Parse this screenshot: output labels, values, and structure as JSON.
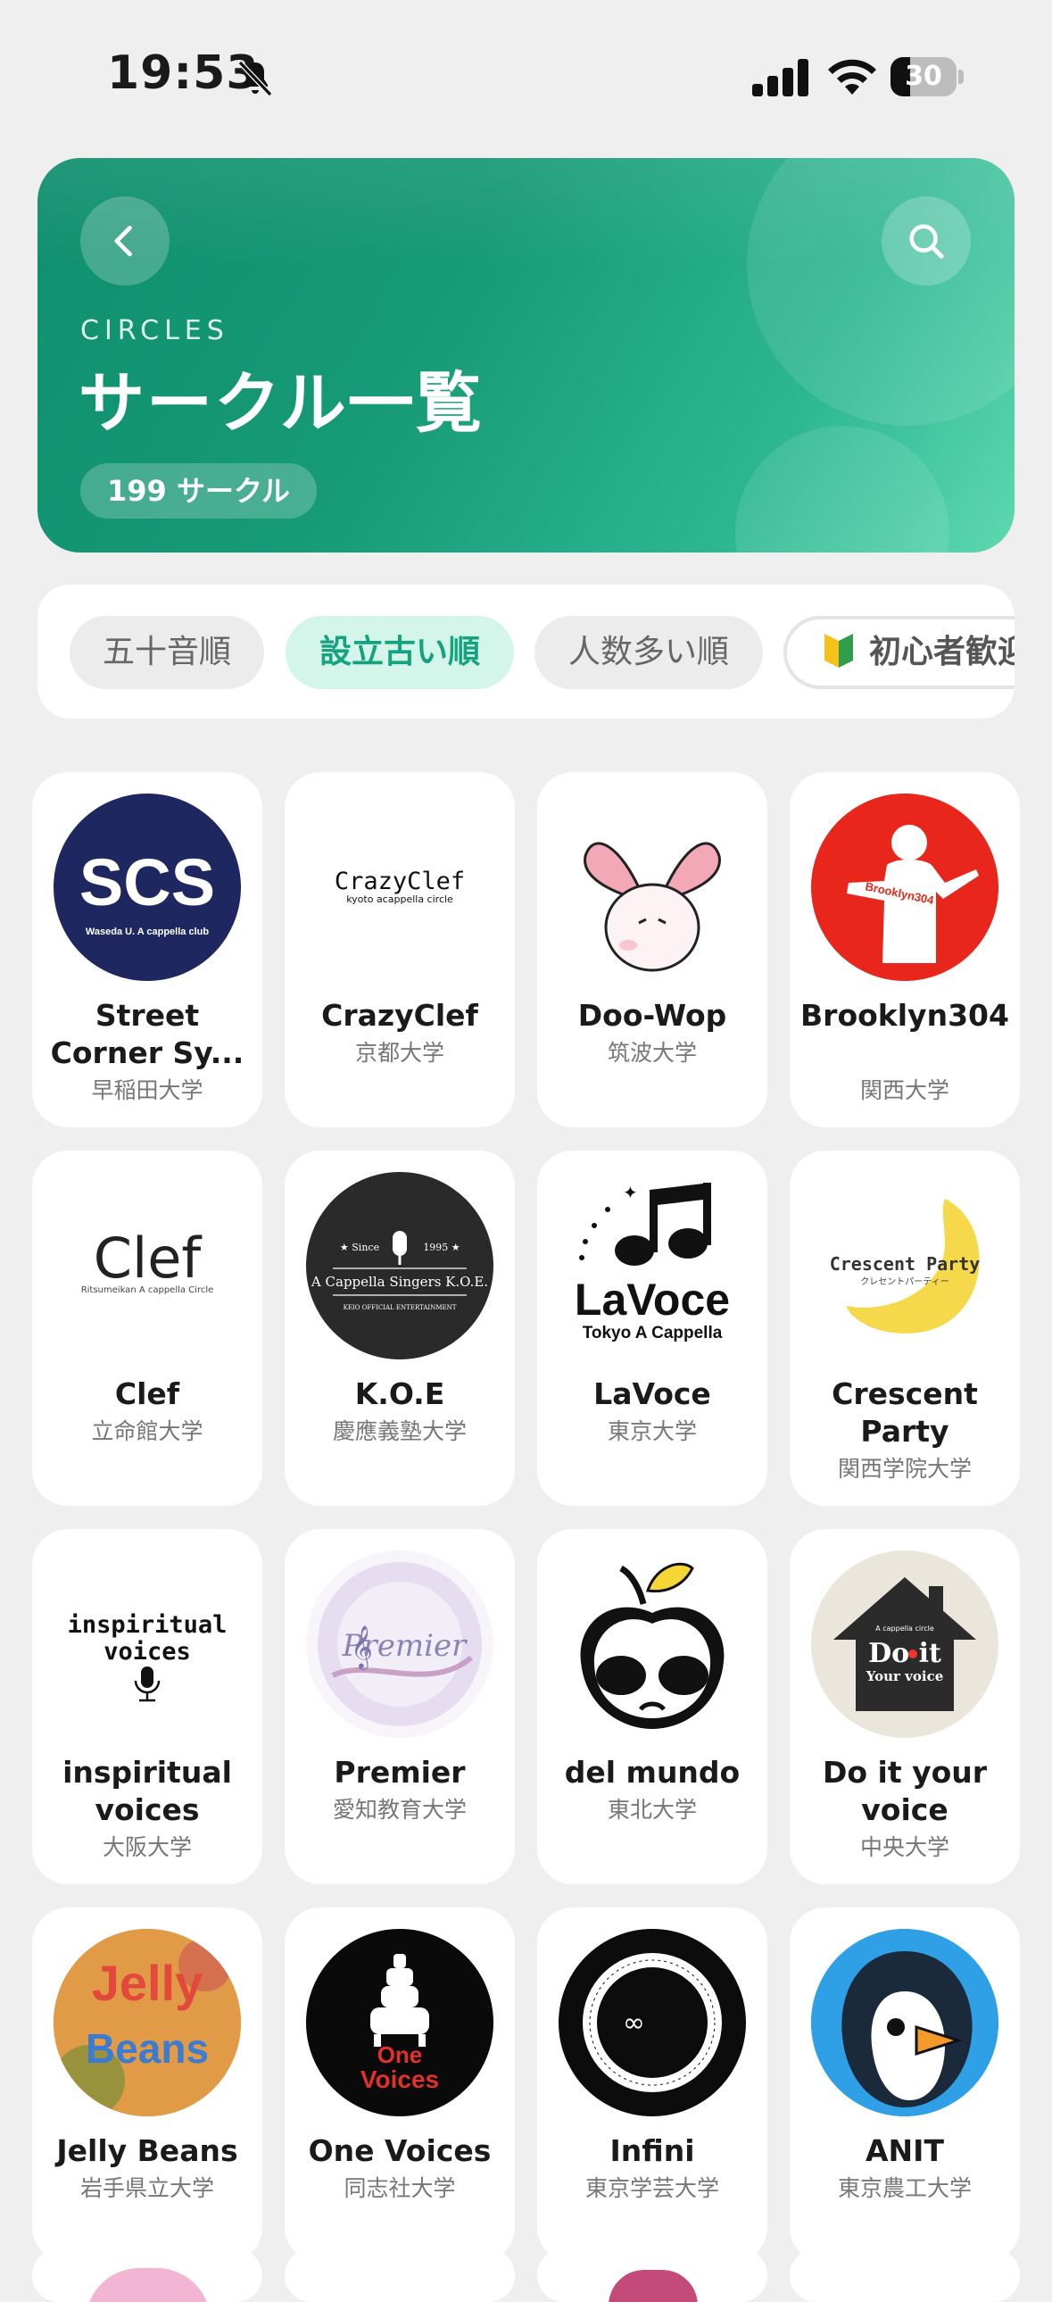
{
  "status": {
    "time": "19:53",
    "battery": "30",
    "battery_level": 0.3
  },
  "header": {
    "overline": "CIRCLES",
    "title": "サークル一覧",
    "count": "199 サークル"
  },
  "filters": [
    {
      "label": "五十音順",
      "active": false
    },
    {
      "label": "設立古い順",
      "active": true
    },
    {
      "label": "人数多い順",
      "active": false
    },
    {
      "label": "初心者歓迎",
      "active": false
    }
  ],
  "circles": [
    {
      "name": "Street Corner Sy...",
      "university": "早稲田大学",
      "logo_text": "SCS",
      "logo_sub": "Waseda U. A cappella club"
    },
    {
      "name": "CrazyClef",
      "university": "京都大学",
      "logo_text": "CrazyClef",
      "logo_sub": "kyoto acappella circle"
    },
    {
      "name": "Doo-Wop",
      "university": "筑波大学"
    },
    {
      "name": "Brooklyn304",
      "university": "関西大学",
      "logo_text": "Brooklyn304"
    },
    {
      "name": "Clef",
      "university": "立命館大学",
      "logo_text": "Clef",
      "logo_sub": "Ritsumeikan A cappella Circle"
    },
    {
      "name": "K.O.E",
      "university": "慶應義塾大学",
      "logo_text": "A Cappella Singers K.O.E.",
      "logo_sub": "KEIO OFFICIAL ENTERTAINMENT",
      "logo_since": "★ Since",
      "logo_year": "1995 ★"
    },
    {
      "name": "LaVoce",
      "university": "東京大学",
      "logo_text": "LaVoce",
      "logo_sub": "Tokyo A Cappella"
    },
    {
      "name": "Crescent Party",
      "university": "関西学院大学",
      "logo_text": "Crescent Party",
      "logo_sub": "クレセントパーティー"
    },
    {
      "name": "inspiritual voices",
      "university": "大阪大学",
      "logo_text": "inspiritual",
      "logo_text2": "voices"
    },
    {
      "name": "Premier",
      "university": "愛知教育大学",
      "logo_text": "Premier"
    },
    {
      "name": "del mundo",
      "university": "東北大学"
    },
    {
      "name": "Do it your voice",
      "university": "中央大学",
      "logo_text": "Do it",
      "logo_sub": "Your voice",
      "logo_top": "A cappella circle"
    },
    {
      "name": "Jelly Beans",
      "university": "岩手県立大学",
      "logo_text": "Jelly Beans"
    },
    {
      "name": "One Voices",
      "university": "同志社大学",
      "logo_text": "One",
      "logo_text2": "Voices"
    },
    {
      "name": "Infini",
      "university": "東京学芸大学",
      "logo_text": "∞"
    },
    {
      "name": "ANIT",
      "university": "東京農工大学"
    }
  ],
  "colors": {
    "accent": "#14a27f",
    "header_start": "#0f8f6e",
    "header_end": "#5ed8b0"
  }
}
